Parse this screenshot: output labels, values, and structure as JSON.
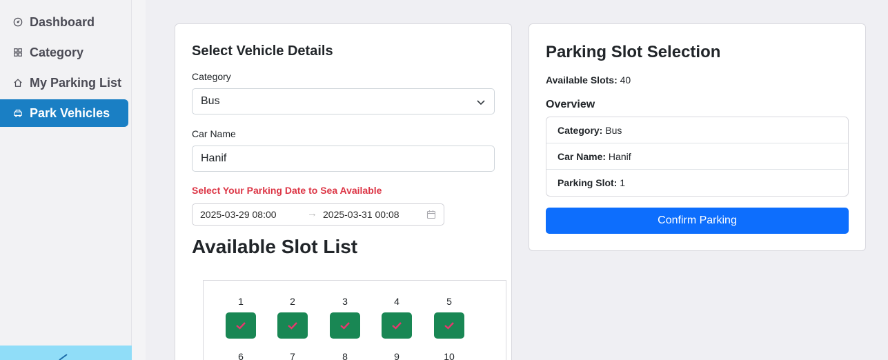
{
  "sidebar": {
    "items": [
      {
        "label": "Dashboard",
        "icon": "gauge-icon",
        "active": false
      },
      {
        "label": "Category",
        "icon": "grid-icon",
        "active": false
      },
      {
        "label": "My Parking List",
        "icon": "home-icon",
        "active": false
      },
      {
        "label": "Park Vehicles",
        "icon": "car-icon",
        "active": true
      }
    ],
    "accent": "#1a7fc4"
  },
  "vehicle": {
    "title": "Select Vehicle Details",
    "category_label": "Category",
    "category_value": "Bus",
    "car_name_label": "Car Name",
    "car_name_value": "Hanif",
    "date_prompt": "Select Your Parking Date to Sea Available",
    "start_date": "2025-03-29 08:00",
    "end_date": "2025-03-31 00:08",
    "range_separator": "→"
  },
  "slots": {
    "title": "Available Slot List",
    "row1": [
      "1",
      "2",
      "3",
      "4",
      "5"
    ],
    "row2": [
      "6",
      "7",
      "8",
      "9",
      "10"
    ]
  },
  "parking": {
    "title": "Parking Slot Selection",
    "available_label": "Available Slots:",
    "available_value": "40",
    "overview_title": "Overview",
    "overview": [
      {
        "label": "Category:",
        "value": "Bus"
      },
      {
        "label": "Car Name:",
        "value": "Hanif"
      },
      {
        "label": "Parking Slot:",
        "value": "1"
      }
    ],
    "confirm_label": "Confirm Parking"
  },
  "colors": {
    "slot_green": "#198754",
    "check_pink": "#e8366e",
    "primary": "#0d6efd",
    "warning_red": "#dc3545"
  }
}
